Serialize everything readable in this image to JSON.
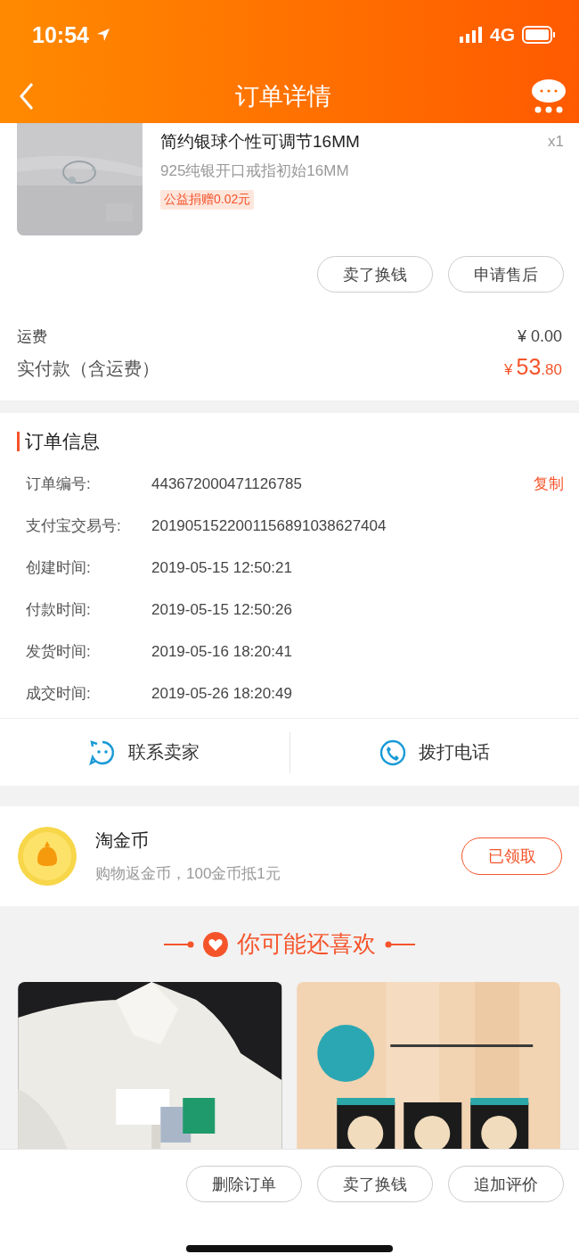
{
  "status_bar": {
    "time": "10:54",
    "network": "4G"
  },
  "header": {
    "title": "订单详情"
  },
  "product": {
    "title": "简约银球个性可调节16MM",
    "quantity": "x1",
    "sku": "925纯银开口戒指初始16MM",
    "tag": "公益捐赠0.02元"
  },
  "item_actions": [
    "卖了换钱",
    "申请售后"
  ],
  "summary": {
    "freight_label": "运费",
    "freight_value": "¥ 0.00",
    "total_label": "实付款（含运费）",
    "total_currency": "¥",
    "total_integer": "53",
    "total_decimals": ".80"
  },
  "order_info": {
    "title": "订单信息",
    "rows": [
      {
        "label": "订单编号:",
        "value": "443672000471126785",
        "action": "复制"
      },
      {
        "label": "支付宝交易号:",
        "value": "2019051522001156891038627404"
      },
      {
        "label": "创建时间:",
        "value": "2019-05-15 12:50:21"
      },
      {
        "label": "付款时间:",
        "value": "2019-05-15 12:50:26"
      },
      {
        "label": "发货时间:",
        "value": "2019-05-16 18:20:41"
      },
      {
        "label": "成交时间:",
        "value": "2019-05-26 18:20:49"
      }
    ]
  },
  "contact": [
    {
      "kind": "chat",
      "label": "联系卖家"
    },
    {
      "kind": "phone",
      "label": "拨打电话"
    }
  ],
  "coins": {
    "title": "淘金币",
    "subtitle": "购物返金币，100金币抵1元",
    "button": "已领取"
  },
  "recommend": {
    "title": "你可能还喜欢"
  },
  "bottom_actions": [
    "删除订单",
    "卖了换钱",
    "追加评价"
  ]
}
